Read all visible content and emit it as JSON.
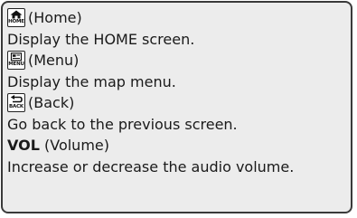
{
  "entries": [
    {
      "icon": "home-icon",
      "icon_caption": "HOME",
      "name": "(Home)",
      "description": "Display the HOME screen."
    },
    {
      "icon": "menu-icon",
      "icon_caption": "MENU",
      "name": "(Menu)",
      "description": "Display the map menu."
    },
    {
      "icon": "back-icon",
      "icon_caption": "BACK",
      "name": "(Back)",
      "description": "Go back to the previous screen."
    },
    {
      "label": "VOL",
      "name": "(Volume)",
      "description": "Increase or decrease the audio volume."
    }
  ]
}
